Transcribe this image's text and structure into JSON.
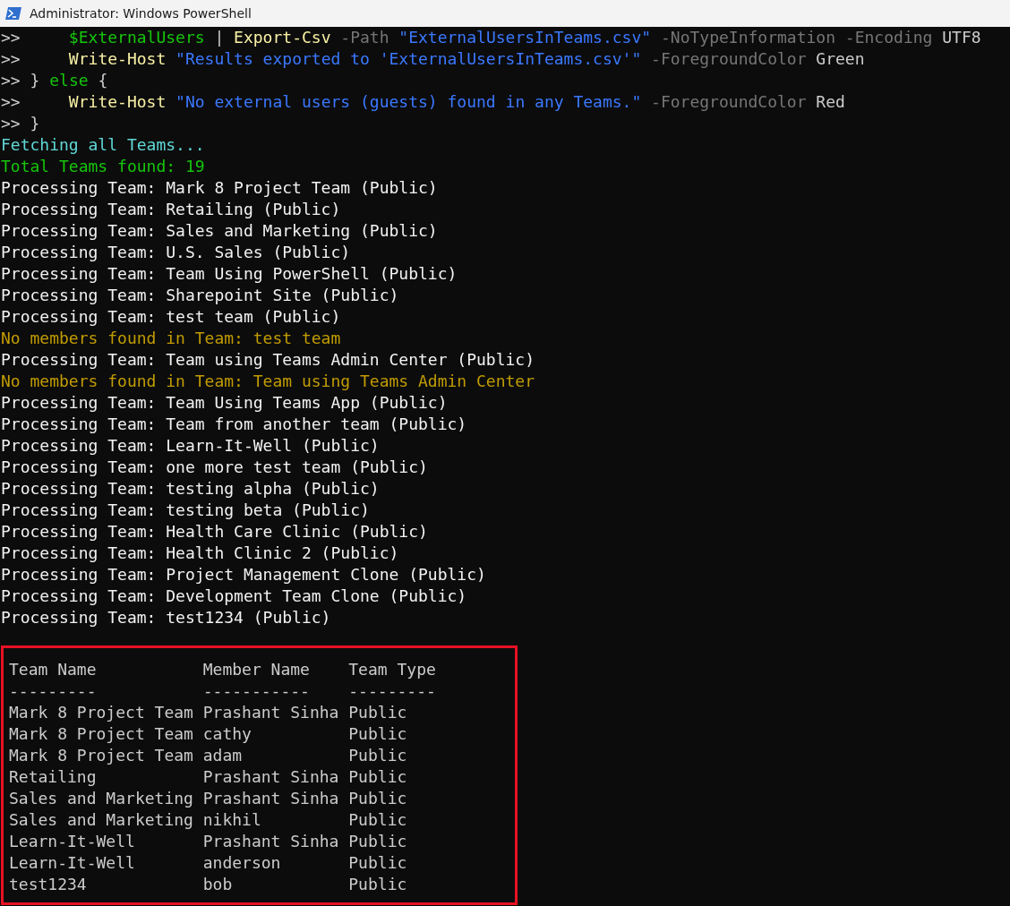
{
  "window": {
    "title": "Administrator: Windows PowerShell"
  },
  "code_lines": [
    {
      "tokens": [
        {
          "kind": "prompt",
          "text": ">>"
        },
        {
          "kind": "variable",
          "text": "     $ExternalUsers"
        },
        {
          "kind": "plain",
          "text": " | "
        },
        {
          "kind": "command",
          "text": "Export-Csv"
        },
        {
          "kind": "param",
          "text": " -Path"
        },
        {
          "kind": "string",
          "text": " \"ExternalUsersInTeams.csv\""
        },
        {
          "kind": "param",
          "text": " -NoTypeInformation -Encoding"
        },
        {
          "kind": "plain",
          "text": " UTF8"
        }
      ]
    },
    {
      "tokens": [
        {
          "kind": "prompt",
          "text": ">>"
        },
        {
          "kind": "command",
          "text": "     Write-Host"
        },
        {
          "kind": "string",
          "text": " \"Results exported to 'ExternalUsersInTeams.csv'\""
        },
        {
          "kind": "param",
          "text": " -ForegroundColor"
        },
        {
          "kind": "plain",
          "text": " Green"
        }
      ]
    },
    {
      "tokens": [
        {
          "kind": "prompt",
          "text": ">>"
        },
        {
          "kind": "plain",
          "text": " }"
        },
        {
          "kind": "keyword",
          "text": " else"
        },
        {
          "kind": "plain",
          "text": " {"
        }
      ]
    },
    {
      "tokens": [
        {
          "kind": "prompt",
          "text": ">>"
        },
        {
          "kind": "command",
          "text": "     Write-Host"
        },
        {
          "kind": "string",
          "text": " \"No external users (guests) found in any Teams.\""
        },
        {
          "kind": "param",
          "text": " -ForegroundColor"
        },
        {
          "kind": "plain",
          "text": " Red"
        }
      ]
    },
    {
      "tokens": [
        {
          "kind": "prompt",
          "text": ">>"
        },
        {
          "kind": "plain",
          "text": " }"
        }
      ]
    }
  ],
  "output_lines": [
    {
      "kind": "info",
      "text": "Fetching all Teams..."
    },
    {
      "kind": "success",
      "text": "Total Teams found: 19"
    },
    {
      "kind": "normal",
      "text": "Processing Team: Mark 8 Project Team (Public)"
    },
    {
      "kind": "normal",
      "text": "Processing Team: Retailing (Public)"
    },
    {
      "kind": "normal",
      "text": "Processing Team: Sales and Marketing (Public)"
    },
    {
      "kind": "normal",
      "text": "Processing Team: U.S. Sales (Public)"
    },
    {
      "kind": "normal",
      "text": "Processing Team: Team Using PowerShell (Public)"
    },
    {
      "kind": "normal",
      "text": "Processing Team: Sharepoint Site (Public)"
    },
    {
      "kind": "normal",
      "text": "Processing Team: test team (Public)"
    },
    {
      "kind": "warning",
      "text": "No members found in Team: test team"
    },
    {
      "kind": "normal",
      "text": "Processing Team: Team using Teams Admin Center (Public)"
    },
    {
      "kind": "warning",
      "text": "No members found in Team: Team using Teams Admin Center"
    },
    {
      "kind": "normal",
      "text": "Processing Team: Team Using Teams App (Public)"
    },
    {
      "kind": "normal",
      "text": "Processing Team: Team from another team (Public)"
    },
    {
      "kind": "normal",
      "text": "Processing Team: Learn-It-Well (Public)"
    },
    {
      "kind": "normal",
      "text": "Processing Team: one more test team (Public)"
    },
    {
      "kind": "normal",
      "text": "Processing Team: testing alpha (Public)"
    },
    {
      "kind": "normal",
      "text": "Processing Team: testing beta (Public)"
    },
    {
      "kind": "normal",
      "text": "Processing Team: Health Care Clinic (Public)"
    },
    {
      "kind": "normal",
      "text": "Processing Team: Health Clinic 2 (Public)"
    },
    {
      "kind": "normal",
      "text": "Processing Team: Project Management Clone (Public)"
    },
    {
      "kind": "normal",
      "text": "Processing Team: Development Team Clone (Public)"
    },
    {
      "kind": "normal",
      "text": "Processing Team: test1234 (Public)"
    }
  ],
  "table": {
    "columns": [
      "Team Name",
      "Member Name",
      "Team Type"
    ],
    "separators": [
      "---------",
      "-----------",
      "---------"
    ],
    "rows": [
      [
        "Mark 8 Project Team",
        "Prashant Sinha",
        "Public"
      ],
      [
        "Mark 8 Project Team",
        "cathy",
        "Public"
      ],
      [
        "Mark 8 Project Team",
        "adam",
        "Public"
      ],
      [
        "Retailing",
        "Prashant Sinha",
        "Public"
      ],
      [
        "Sales and Marketing",
        "Prashant Sinha",
        "Public"
      ],
      [
        "Sales and Marketing",
        "nikhil",
        "Public"
      ],
      [
        "Learn-It-Well",
        "Prashant Sinha",
        "Public"
      ],
      [
        "Learn-It-Well",
        "anderson",
        "Public"
      ],
      [
        "test1234",
        "bob",
        "Public"
      ]
    ]
  }
}
